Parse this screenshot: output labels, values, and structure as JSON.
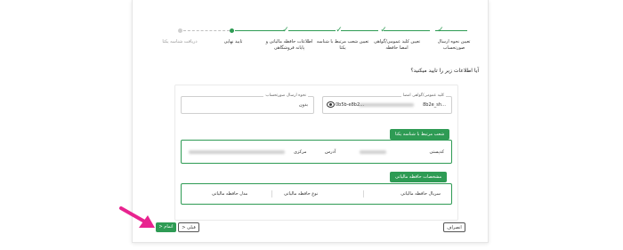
{
  "stepper": {
    "steps": [
      {
        "label": "تعیین نحوه ارسال صورتحساب",
        "state": "done"
      },
      {
        "label": "تعیین کلید عمومی/گواهی امضا حافظه",
        "state": "done"
      },
      {
        "label": "تعیین شعب مرتبط با شناسه یکتا",
        "state": "done"
      },
      {
        "label": "اطلاعات حافظه مالیاتی و پایانه فروشگاهی",
        "state": "done"
      },
      {
        "label": "تایید نهایی",
        "state": "current"
      },
      {
        "label": "دریافت شناسه یکتا",
        "state": "todo"
      }
    ],
    "check_glyph": "✓"
  },
  "question": "آیا اطلاعات زیر را تایید میکنید؟",
  "key_field": {
    "label": "کلید عمومی/گواهی امضا",
    "value_prefix": "…8b2e_sh",
    "value_suffix": "…0b5b-e8b2",
    "eye_icon": "eye-icon"
  },
  "method_field": {
    "label": "نحوه ارسال صورتحساب",
    "value": "بدون"
  },
  "branches": {
    "badge": "شعب مرتبط با شناسه یکتا",
    "branch_name": "کدپستی",
    "address_label": "آدرس",
    "branch_type": "مرکزی"
  },
  "memory": {
    "badge": "مشخصات حافظه مالیاتی",
    "serial_label": "سریال حافظه مالیاتی",
    "type_label": "نوع حافظه مالیاتی",
    "model_label": "مدل حافظه مالیاتی"
  },
  "buttons": {
    "cancel": "انصراف",
    "back": "قبلی",
    "back_icon": "<",
    "finish": "اتمام",
    "finish_icon": "<"
  },
  "colors": {
    "accent": "#2e9b54",
    "annotation_arrow": "#e8238f"
  }
}
